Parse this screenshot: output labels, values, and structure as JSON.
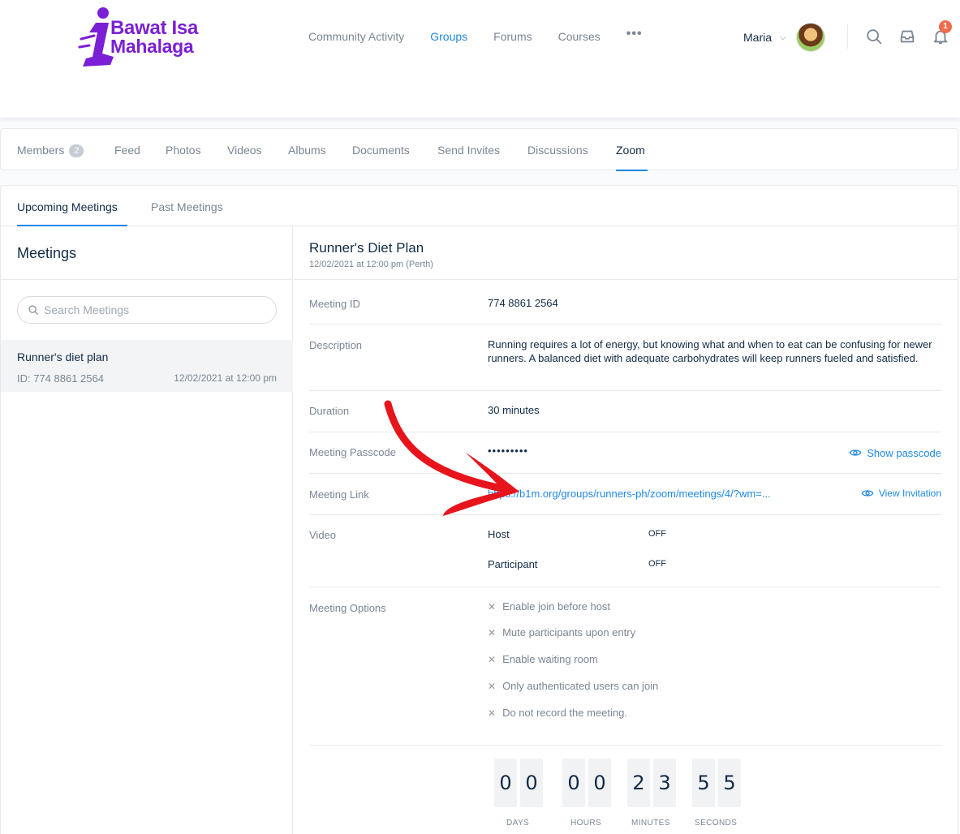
{
  "brand": {
    "line1": "Bawat Isa",
    "line2": "Mahalaga",
    "color": "#7a1fd6"
  },
  "nav": {
    "items": [
      "Community Activity",
      "Groups",
      "Forums",
      "Courses"
    ],
    "more": "•••",
    "active": "Groups"
  },
  "user": {
    "name": "Maria",
    "notifications": "1"
  },
  "icons": {
    "search": "search-icon",
    "inbox": "inbox-icon",
    "bell": "bell-icon",
    "eye": "eye-icon"
  },
  "group_tabs": {
    "members_label": "Members",
    "members_count": "2",
    "items": [
      "Feed",
      "Photos",
      "Videos",
      "Albums",
      "Documents",
      "Send Invites",
      "Discussions",
      "Zoom"
    ],
    "active": "Zoom"
  },
  "zoom": {
    "subtabs": [
      "Upcoming Meetings",
      "Past Meetings"
    ],
    "meetings_title": "Meetings",
    "search_placeholder": "Search Meetings",
    "list": [
      {
        "title": "Runner's diet plan",
        "id": "ID: 774 8861 2564",
        "date": "12/02/2021 at 12:00 pm"
      }
    ],
    "detail": {
      "title": "Runner's Diet Plan",
      "subtitle": "12/02/2021 at 12:00 pm (Perth)",
      "meeting_id_label": "Meeting ID",
      "meeting_id": "774 8861 2564",
      "description_label": "Description",
      "description": "Running requires a lot of energy, but knowing what and when to eat can be confusing for newer runners. A balanced diet with adequate carbohydrates will keep runners fueled and satisfied.",
      "duration_label": "Duration",
      "duration": "30 minutes",
      "passcode_label": "Meeting Passcode",
      "passcode": "•••••••••",
      "show_passcode": "Show passcode",
      "link_label": "Meeting Link",
      "link": "https://b1m.org/groups/runners-ph/zoom/meetings/4/?wm=...",
      "view_invitation": "View Invitation",
      "video_label": "Video",
      "host_label": "Host",
      "host_value": "OFF",
      "participant_label": "Participant",
      "participant_value": "OFF",
      "options_label": "Meeting Options",
      "options": [
        "Enable join before host",
        "Mute participants upon entry",
        "Enable waiting room",
        "Only authenticated users can join",
        "Do not record the meeting."
      ]
    },
    "countdown": {
      "days": [
        "0",
        "0"
      ],
      "hours": [
        "0",
        "0"
      ],
      "minutes": [
        "2",
        "3"
      ],
      "seconds": [
        "5",
        "5"
      ],
      "labels": [
        "DAYS",
        "HOURS",
        "MINUTES",
        "SECONDS"
      ]
    }
  },
  "colors": {
    "accent": "#1e88e5",
    "annotation_arrow": "#e8141c",
    "notification": "#ef6c4c"
  }
}
